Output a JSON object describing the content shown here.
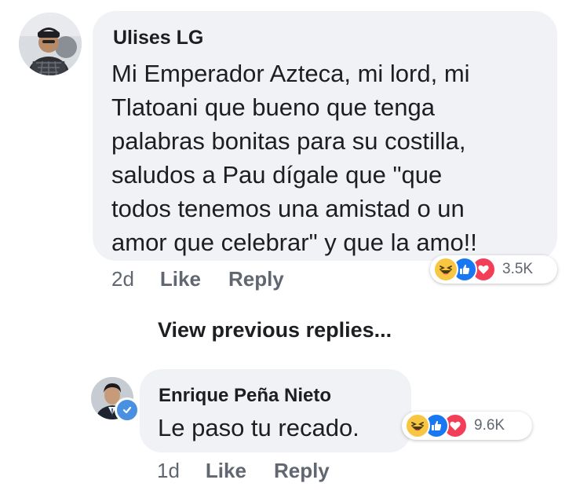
{
  "comment": {
    "author": "Ulises LG",
    "text_lines": [
      "Mi Emperador Azteca, mi lord, mi",
      "Tlatoani que bueno que tenga",
      "palabras bonitas para su costilla,",
      "saludos a Pau dígale que \"que",
      "todos tenemos una amistad o un",
      "amor que celebrar\" y que la amo!!"
    ],
    "time": "2d",
    "like_label": "Like",
    "reply_label": "Reply",
    "reactions": {
      "types": [
        "haha-icon",
        "like-icon",
        "love-icon"
      ],
      "count": "3.5K"
    }
  },
  "view_previous_replies": "View previous replies...",
  "reply": {
    "author": "Enrique Peña Nieto",
    "verified": true,
    "text": "Le paso tu recado.",
    "time": "1d",
    "like_label": "Like",
    "reply_label": "Reply",
    "reactions": {
      "types": [
        "haha-icon",
        "like-icon",
        "love-icon"
      ],
      "count": "9.6K"
    }
  },
  "colors": {
    "bubble": "#f0f2f5",
    "text": "#1c1e21",
    "secondary_text": "#606770",
    "like_blue": "#1877f2",
    "love_red": "#f33e58",
    "haha_yellow": "#f7c744",
    "verified_blue": "#4a90e2"
  }
}
